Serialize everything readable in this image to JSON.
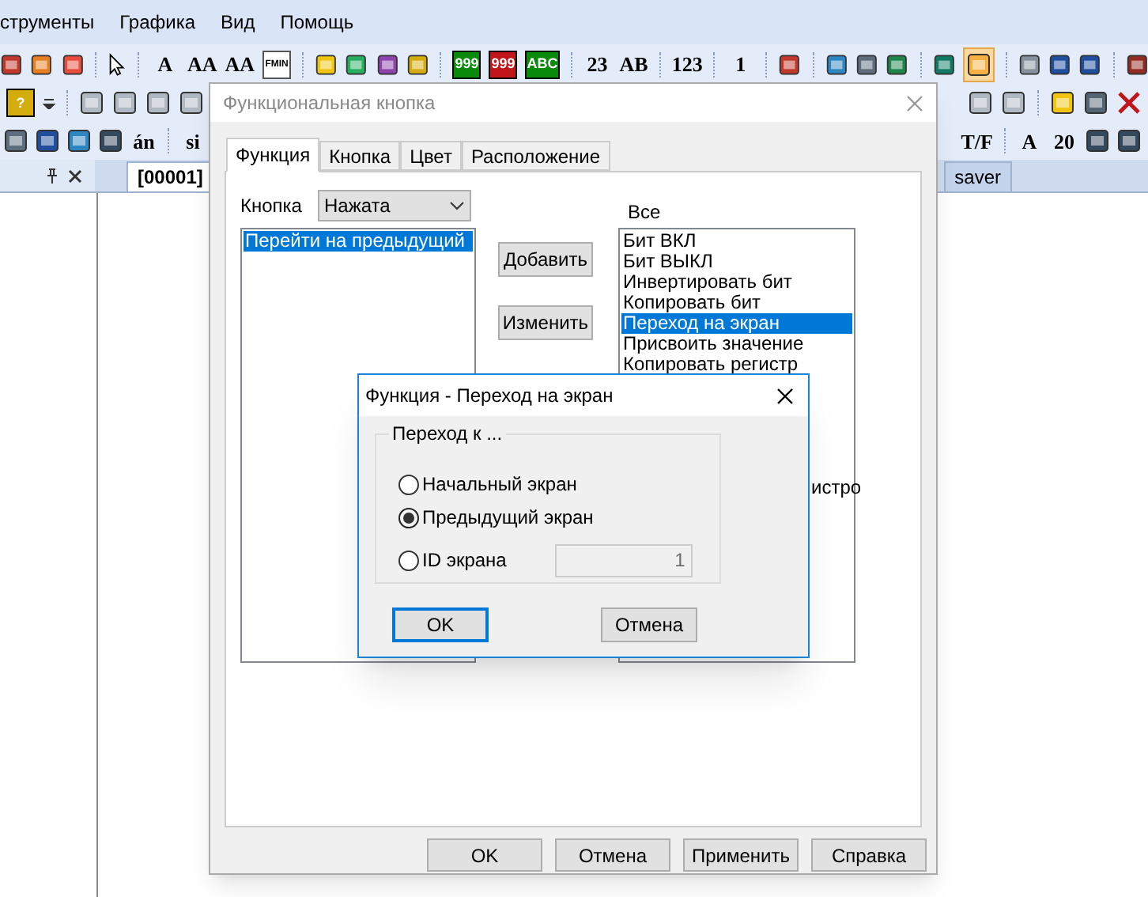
{
  "menu": [
    {
      "label": "струменты"
    },
    {
      "label": "Графика"
    },
    {
      "label": "Вид"
    },
    {
      "label": "Помощь"
    }
  ],
  "toolbar_1": [
    {
      "kind": "icon",
      "color": "#c0392b"
    },
    {
      "kind": "icon",
      "color": "#e67e22"
    },
    {
      "kind": "icon",
      "color": "#e74c3c"
    },
    {
      "kind": "sep"
    },
    {
      "kind": "cursor"
    },
    {
      "kind": "sep"
    },
    {
      "kind": "glyph",
      "text": "A"
    },
    {
      "kind": "glyph",
      "text": "AA"
    },
    {
      "kind": "glyph",
      "text": "AA"
    },
    {
      "kind": "glyph",
      "text": "FMIN"
    },
    {
      "kind": "sep"
    },
    {
      "kind": "icon",
      "color": "#f1c40f"
    },
    {
      "kind": "icon",
      "color": "#27ae60"
    },
    {
      "kind": "icon",
      "color": "#8e44ad"
    },
    {
      "kind": "icon",
      "color": "#d4ac0d"
    },
    {
      "kind": "sep"
    },
    {
      "kind": "glyph",
      "text": "999",
      "color": "#0a8a0a"
    },
    {
      "kind": "glyph",
      "text": "999",
      "color": "#c0151b"
    },
    {
      "kind": "glyph",
      "text": "ABC",
      "color": "#0a8a0a"
    },
    {
      "kind": "sep"
    },
    {
      "kind": "glyph",
      "text": "23"
    },
    {
      "kind": "glyph",
      "text": "AB"
    },
    {
      "kind": "sep"
    },
    {
      "kind": "glyph",
      "text": "123"
    },
    {
      "kind": "sep"
    },
    {
      "kind": "glyph",
      "text": "1"
    },
    {
      "kind": "sep"
    },
    {
      "kind": "icon",
      "color": "#c0392b"
    },
    {
      "kind": "sep"
    },
    {
      "kind": "icon",
      "color": "#2e86c1"
    },
    {
      "kind": "icon",
      "color": "#5d6d7e"
    },
    {
      "kind": "icon",
      "color": "#1e8449"
    },
    {
      "kind": "sep"
    },
    {
      "kind": "icon",
      "color": "#117a65"
    },
    {
      "kind": "icon",
      "color": "#f5b041",
      "selected": true
    },
    {
      "kind": "sep"
    },
    {
      "kind": "icon",
      "color": "#85929e"
    },
    {
      "kind": "icon",
      "color": "#1f4e9c"
    },
    {
      "kind": "icon",
      "color": "#1f4e9c"
    },
    {
      "kind": "sep"
    },
    {
      "kind": "icon",
      "color": "#922b21"
    }
  ],
  "toolbar_2_left": [
    {
      "kind": "glyph",
      "text": "?",
      "color": "#d4ac0d"
    },
    {
      "kind": "caret"
    },
    {
      "kind": "sep"
    },
    {
      "kind": "icon",
      "color": "#b0b8c4"
    },
    {
      "kind": "icon",
      "color": "#b0b8c4"
    },
    {
      "kind": "icon",
      "color": "#b0b8c4"
    },
    {
      "kind": "icon",
      "color": "#b0b8c4"
    }
  ],
  "toolbar_2_right": [
    {
      "kind": "icon",
      "color": "#b0b8c4"
    },
    {
      "kind": "icon",
      "color": "#b0b8c4"
    },
    {
      "kind": "sep"
    },
    {
      "kind": "icon",
      "color": "#f1c40f"
    },
    {
      "kind": "icon",
      "color": "#566573"
    },
    {
      "kind": "close"
    }
  ],
  "toolbar_3_left": [
    {
      "kind": "icon",
      "color": "#5d6d7e"
    },
    {
      "kind": "icon",
      "color": "#1f4e9c"
    },
    {
      "kind": "icon",
      "color": "#2e86c1"
    },
    {
      "kind": "icon",
      "color": "#34495e"
    },
    {
      "kind": "glyph",
      "text": "án"
    },
    {
      "kind": "sep"
    },
    {
      "kind": "glyph",
      "text": "si"
    }
  ],
  "toolbar_3_right": [
    {
      "kind": "glyph",
      "text": "T/F"
    },
    {
      "kind": "sep"
    },
    {
      "kind": "glyph",
      "text": "A"
    },
    {
      "kind": "glyph",
      "text": "20"
    },
    {
      "kind": "icon",
      "color": "#34495e"
    },
    {
      "kind": "icon",
      "color": "#34495e"
    }
  ],
  "doc_tabs": [
    {
      "label": "[00001]",
      "selected": true
    },
    {
      "label": "saver",
      "selected": false
    }
  ],
  "dialog": {
    "title": "Функциональная кнопка",
    "active": false,
    "tabs": [
      {
        "label": "Функция",
        "selected": true
      },
      {
        "label": "Кнопка",
        "selected": false
      },
      {
        "label": "Цвет",
        "selected": false
      },
      {
        "label": "Расположение",
        "selected": false
      }
    ],
    "button_label": "Кнопка",
    "button_state": "Нажата",
    "actions": [
      {
        "label": "Перейти на предыдущий",
        "selected": true
      }
    ],
    "action_buttons": [
      "Добавить",
      "Изменить"
    ],
    "all_label": "Все",
    "functions": [
      {
        "label": "Бит ВКЛ",
        "selected": false
      },
      {
        "label": "Бит ВЫКЛ",
        "selected": false
      },
      {
        "label": "Инвертировать бит",
        "selected": false
      },
      {
        "label": "Копировать бит",
        "selected": false
      },
      {
        "label": "Переход на экран",
        "selected": true
      },
      {
        "label": "Присвоить значение",
        "selected": false
      },
      {
        "label": "Копировать регистр",
        "selected": false
      }
    ],
    "function_cut": "истро",
    "footer_buttons": [
      "OK",
      "Отмена",
      "Применить",
      "Справка"
    ]
  },
  "subdialog": {
    "title": "Функция - Переход на экран",
    "group": "Переход к ...",
    "options": [
      {
        "label": "Начальный экран",
        "selected": false
      },
      {
        "label": "Предыдущий экран",
        "selected": true
      },
      {
        "label": "ID экрана",
        "selected": false
      }
    ],
    "screen_id": {
      "value": "1",
      "disabled": true
    },
    "buttons": [
      {
        "label": "OK",
        "default": true
      },
      {
        "label": "Отмена",
        "default": false
      }
    ]
  }
}
